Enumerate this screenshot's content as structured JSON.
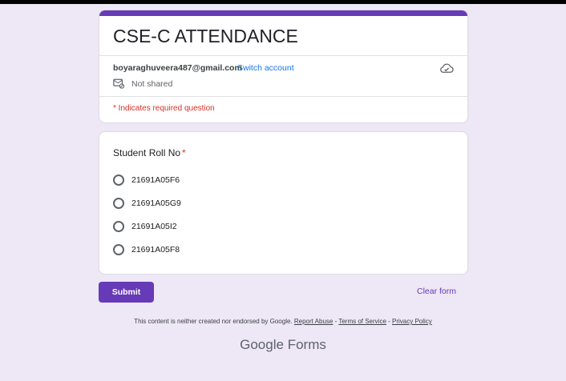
{
  "form": {
    "title": "CSE-C ATTENDANCE",
    "account_email": "boyaraghuveera487@gmail.com",
    "switch_account": "Switch account",
    "not_shared": "Not shared",
    "required_note": "* Indicates required question"
  },
  "question": {
    "title": "Student Roll No",
    "required_marker": "*",
    "options": [
      {
        "label": "21691A05F6",
        "selected": false
      },
      {
        "label": "21691A05G9",
        "selected": false
      },
      {
        "label": "21691A05I2",
        "selected": false
      },
      {
        "label": "21691A05F8",
        "selected": false
      }
    ]
  },
  "actions": {
    "submit": "Submit",
    "clear": "Clear form"
  },
  "footer": {
    "disclaimer": "This content is neither created nor endorsed by Google.",
    "report_abuse": "Report Abuse",
    "sep1": " - ",
    "terms": "Terms of Service",
    "sep2": " - ",
    "privacy": "Privacy Policy",
    "brand_google": "Google",
    "brand_forms": "Forms"
  },
  "colors": {
    "accent": "#673ab7",
    "background": "#ede7f6",
    "required": "#d93025",
    "link": "#1a73e8"
  },
  "icons": {
    "cloud": "cloud-sync-icon",
    "not_shared": "not-shared-icon"
  }
}
